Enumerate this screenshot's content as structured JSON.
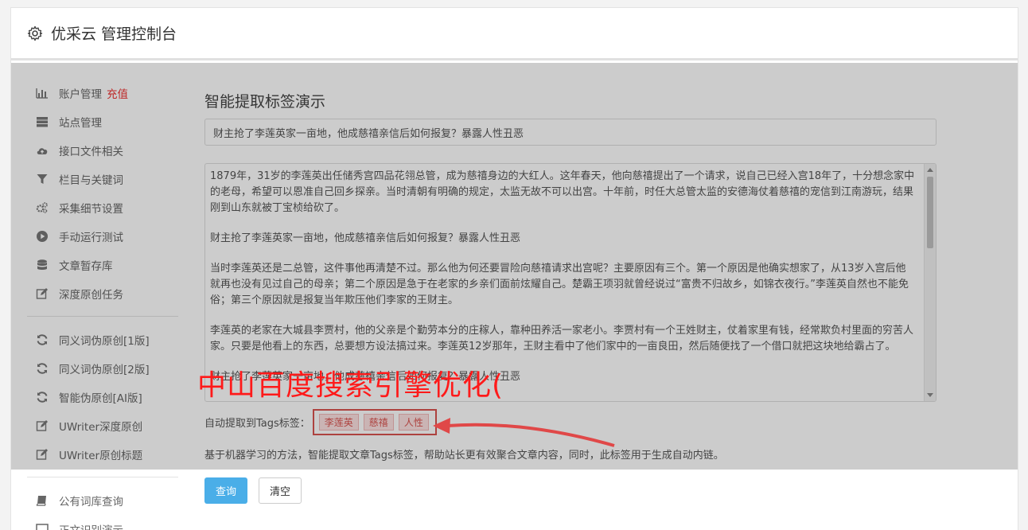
{
  "header": {
    "title": "优采云 管理控制台"
  },
  "sidebar": {
    "group1": [
      {
        "label": "账户管理",
        "extra": "充值",
        "icon": "bar-chart-icon"
      },
      {
        "label": "站点管理",
        "icon": "server-icon"
      },
      {
        "label": "接口文件相关",
        "icon": "cloud-upload-icon"
      },
      {
        "label": "栏目与关键词",
        "icon": "filter-icon"
      },
      {
        "label": "采集细节设置",
        "icon": "gears-icon"
      },
      {
        "label": "手动运行测试",
        "icon": "play-icon"
      },
      {
        "label": "文章暂存库",
        "icon": "database-icon"
      },
      {
        "label": "深度原创任务",
        "icon": "edit-icon"
      }
    ],
    "group2": [
      {
        "label": "同义词伪原创[1版]",
        "icon": "refresh-icon"
      },
      {
        "label": "同义词伪原创[2版]",
        "icon": "refresh-icon"
      },
      {
        "label": "智能伪原创[AI版]",
        "icon": "refresh-icon"
      },
      {
        "label": "UWriter深度原创",
        "icon": "edit-icon"
      },
      {
        "label": "UWriter原创标题",
        "icon": "edit-icon"
      }
    ],
    "group3": [
      {
        "label": "公有词库查询",
        "icon": "book-icon"
      },
      {
        "label": "正文识别演示",
        "icon": "monitor-icon"
      }
    ]
  },
  "main": {
    "heading": "智能提取标签演示",
    "title_value": "财主抢了李莲英家一亩地，他成慈禧亲信后如何报复？暴露人性丑恶",
    "body_paragraphs": [
      "1879年，31岁的李莲英出任储秀宫四品花翎总管，成为慈禧身边的大红人。这年春天，他向慈禧提出了一个请求，说自己已经入宫18年了，十分想念家中的老母，希望可以恩准自己回乡探亲。当时清朝有明确的规定，太监无故不可以出宫。十年前，时任大总管太监的安德海仗着慈禧的宠信到江南游玩，结果刚到山东就被丁宝桢给砍了。",
      "财主抢了李莲英家一亩地，他成慈禧亲信后如何报复？暴露人性丑恶",
      "当时李莲英还是二总管，这件事他再清楚不过。那么他为何还要冒险向慈禧请求出宫呢？主要原因有三个。第一个原因是他确实想家了，从13岁入宫后他就再也没有见过自己的母亲；第二个原因是急于在老家的乡亲们面前炫耀自己。楚霸王项羽就曾经说过“富贵不归故乡，如锦衣夜行。”李莲英自然也不能免俗；第三个原因就是报复当年欺压他们李家的王财主。",
      "李莲英的老家在大城县李贾村，他的父亲是个勤劳本分的庄稼人，靠种田养活一家老小。李贾村有一个王姓财主，仗着家里有钱，经常欺负村里面的穷苦人家。只要是他看上的东西，总要想方设法搞过来。李莲英12岁那年，王财主看中了他们家中的一亩良田，然后随便找了一个借口就把这块地给霸占了。",
      "财主抢了李莲英家一亩地，他成慈禧亲信后如何报复？暴露人性丑恶"
    ],
    "tags_label": "自动提取到Tags标签：",
    "tags": [
      "李莲英",
      "慈禧",
      "人性"
    ],
    "description": "基于机器学习的方法，智能提取文章Tags标签，帮助站长更有效聚合文章内容，同时，此标签用于生成自动内链。",
    "query_button": "查询",
    "clear_button": "清空"
  },
  "watermark": {
    "text": "中山百度搜索引擎优化("
  },
  "colors": {
    "accent": "#4aaee8",
    "tag_red": "#d9534f",
    "watermark_red": "#ff1a1a"
  }
}
